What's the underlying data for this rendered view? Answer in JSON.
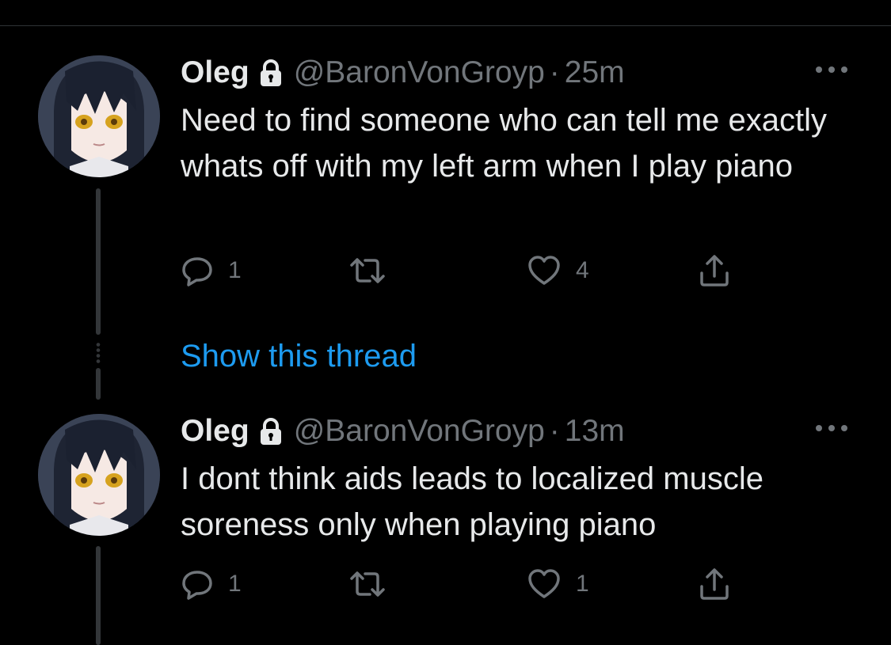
{
  "colors": {
    "background": "#000000",
    "text": "#e7e9ea",
    "secondary": "#71767b",
    "link": "#1d9bf0",
    "thread_line": "#333639"
  },
  "show_thread_label": "Show this thread",
  "tweets": [
    {
      "name": "Oleg",
      "protected_icon": "lock-icon",
      "handle": "@BaronVonGroyp",
      "separator": "·",
      "time": "25m",
      "text": "Need to find someone who can tell me exactly whats off with my left arm when I play piano",
      "replies": "1",
      "retweets": "",
      "likes": "4"
    },
    {
      "name": "Oleg",
      "protected_icon": "lock-icon",
      "handle": "@BaronVonGroyp",
      "separator": "·",
      "time": "13m",
      "text": "I dont think aids leads to localized muscle soreness only when playing piano",
      "replies": "1",
      "retweets": "",
      "likes": "1"
    }
  ]
}
